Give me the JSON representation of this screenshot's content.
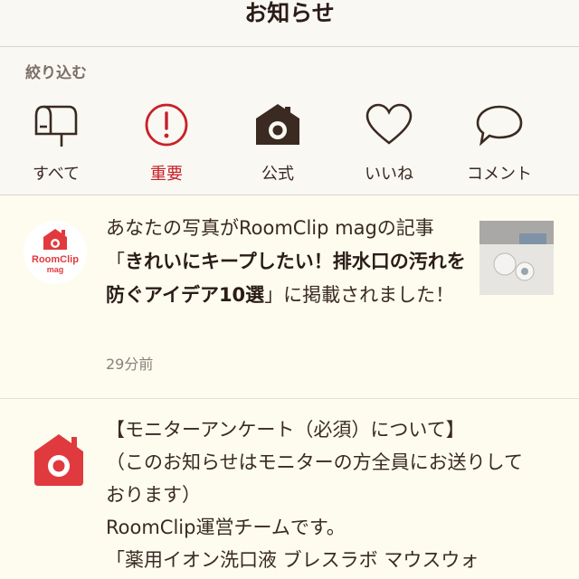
{
  "header": {
    "title": "お知らせ"
  },
  "filter": {
    "label": "絞り込む",
    "items": [
      {
        "label": "すべて",
        "icon": "mailbox-icon"
      },
      {
        "label": "重要",
        "icon": "exclamation-icon"
      },
      {
        "label": "公式",
        "icon": "camera-house-icon"
      },
      {
        "label": "いいね",
        "icon": "heart-icon"
      },
      {
        "label": "コメント",
        "icon": "speech-bubble-icon"
      }
    ]
  },
  "notices": [
    {
      "avatar_text": "RoomClip",
      "avatar_sub": "mag",
      "text_prefix": "あなたの写真がRoomClip magの記事「",
      "text_bold": "きれいにキープしたい！排水口の汚れを防ぐアイデア10選",
      "text_suffix": "」に掲載されました！",
      "time": "29分前"
    },
    {
      "text": "【モニターアンケート（必須）について】\n（このお知らせはモニターの方全員にお送りしております）\nRoomClip運営チームです。\n「薬用イオン洗口液 ブレスラボ マウスウォ"
    }
  ],
  "colors": {
    "brand_red": "#e03a3e",
    "active_red": "#c8202a",
    "icon_dark": "#3a2a22"
  }
}
